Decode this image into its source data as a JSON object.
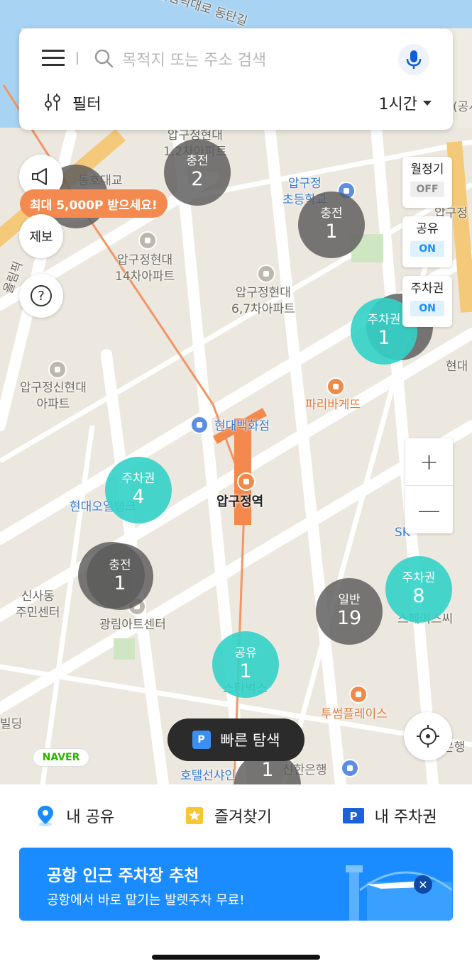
{
  "search": {
    "placeholder": "목적지 또는 주소 검색",
    "filter_label": "필터",
    "time_value": "1시간"
  },
  "map": {
    "labels": {
      "top_road": "올림픽대로 동탄길",
      "apt_12": "압구정현대\n1,2차아파트",
      "elementary": "압구정\n초등학교",
      "apt_14": "압구정현대\n14차아파트",
      "apt_67": "압구정현대\n6,7차아파트",
      "sinhyundai": "압구정신현대\n아파트",
      "paris": "파리바게뜨",
      "hyundai_dept": "현대백화점",
      "station": "압구정역",
      "hyundai_oil": "현대오일뱅크",
      "sinsa": "신사동\n주민센터",
      "kwangrim": "광림아트센터",
      "starbucks": "스타벅스",
      "twosome": "투썸플레이스",
      "hotel": "호텔선샤인",
      "shinhan": "신한은행",
      "sk": "SK",
      "space": "스페이스씨",
      "hyundai_right": "현대",
      "apgu_right": "압구정",
      "olympic": "올림픽",
      "bank_right": "은행",
      "building": "빌딩",
      "dongho": "동호대교",
      "gong": "(공시"
    },
    "markers": [
      {
        "type": "충전",
        "count": "2",
        "style": "gray"
      },
      {
        "type": "충전",
        "count": "1",
        "style": "gray"
      },
      {
        "type": "주차권",
        "count": "1",
        "style": "teal"
      },
      {
        "type": "주차권",
        "count": "4",
        "style": "teal"
      },
      {
        "type": "충전",
        "count": "1",
        "style": "gray"
      },
      {
        "type": "일반",
        "count": "19",
        "style": "gray"
      },
      {
        "type": "주차권",
        "count": "8",
        "style": "teal"
      },
      {
        "type": "공유",
        "count": "1",
        "style": "teal"
      },
      {
        "type": "",
        "count": "1",
        "style": "gray"
      }
    ]
  },
  "left_controls": {
    "promo": "최대 5,000P 받으세요!",
    "report": "제보",
    "help": "?"
  },
  "toggles": [
    {
      "label": "월정기",
      "state": "OFF"
    },
    {
      "label": "공유",
      "state": "ON"
    },
    {
      "label": "주차권",
      "state": "ON"
    }
  ],
  "zoom": {
    "plus": "+",
    "minus": "—"
  },
  "naver_logo": "NAVER",
  "quick_search": {
    "badge": "P",
    "label": "빠른 탐색"
  },
  "bottom_nav": [
    {
      "label": "내 공유",
      "icon": "location-pin-icon"
    },
    {
      "label": "즐겨찾기",
      "icon": "star-icon"
    },
    {
      "label": "내 주차권",
      "icon": "parking-ticket-icon"
    }
  ],
  "banner": {
    "title": "공항 인근 주차장 추천",
    "subtitle": "공항에서 바로 맡기는 발렛주차 무료!",
    "close": "✕"
  },
  "colors": {
    "accent_blue": "#1a8cff",
    "promo_orange": "#f48a4f",
    "teal_marker": "#32d2c8",
    "gray_marker": "#5a5a5a"
  }
}
